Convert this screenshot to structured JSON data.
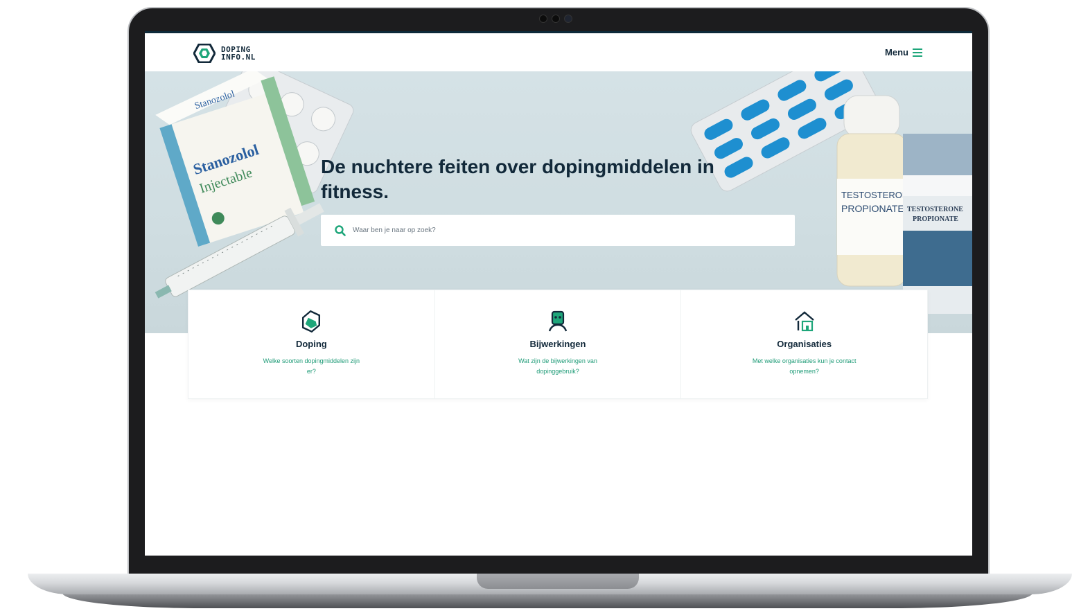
{
  "site": {
    "logo_line1": "DOPING",
    "logo_line2": "INFO.NL",
    "menu_label": "Menu"
  },
  "hero": {
    "title": "De nuchtere feiten over dopingmiddelen in fitness.",
    "search_placeholder": "Waar ben je naar op zoek?",
    "products": {
      "box_left_brand": "Stanozolol",
      "box_left_name1": "Stanozolol",
      "box_left_name2": "Injectable",
      "vial_line1": "TESTOSTERON",
      "vial_line2": "PROPIONATE",
      "box_right_line1": "TESTOSTERONE",
      "box_right_line2": "PROPIONATE"
    }
  },
  "cards": [
    {
      "title": "Doping",
      "description": "Welke soorten dopingmiddelen zijn er?",
      "icon": "pill-icon"
    },
    {
      "title": "Bijwerkingen",
      "description": "Wat zijn de bijwerkingen van dopinggebruik?",
      "icon": "person-icon"
    },
    {
      "title": "Organisaties",
      "description": "Met welke organisaties kun je contact opnemen?",
      "icon": "building-icon"
    }
  ],
  "colors": {
    "navy": "#12293a",
    "accent_green": "#1ea67a",
    "hero_bg": "#d3e0e4",
    "pill_blue": "#1e8fd0"
  }
}
